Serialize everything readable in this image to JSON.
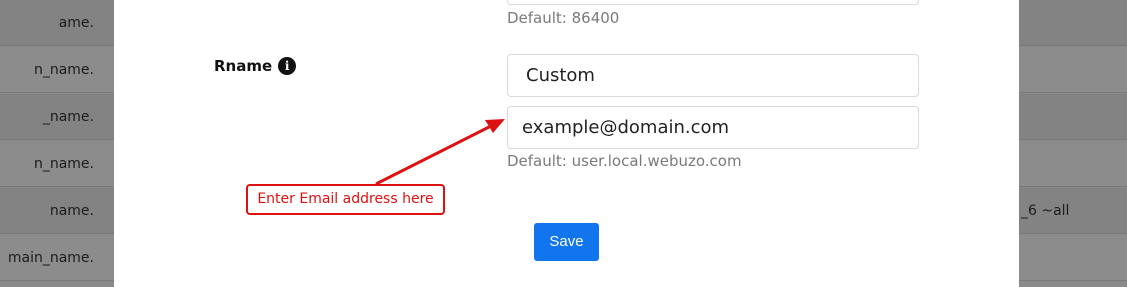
{
  "background_table": {
    "left_rows": [
      "ame.",
      "n_name.",
      "_name.",
      "n_name.",
      "name.",
      "main_name."
    ],
    "right_rows": [
      "",
      "",
      "",
      "",
      "_6 ~all",
      ""
    ]
  },
  "modal": {
    "ttl_default_hint": "Default: 86400",
    "rname": {
      "label": "Rname",
      "info_icon": "info-icon",
      "select_value": "Custom",
      "email_value": "example@domain.com",
      "default_hint": "Default: user.local.webuzo.com"
    },
    "save_label": "Save"
  },
  "annotation": {
    "callout_text": "Enter Email address here",
    "color": "#dd1111"
  },
  "colors": {
    "primary": "#1275ee",
    "overlay": "#8a8a8a"
  }
}
